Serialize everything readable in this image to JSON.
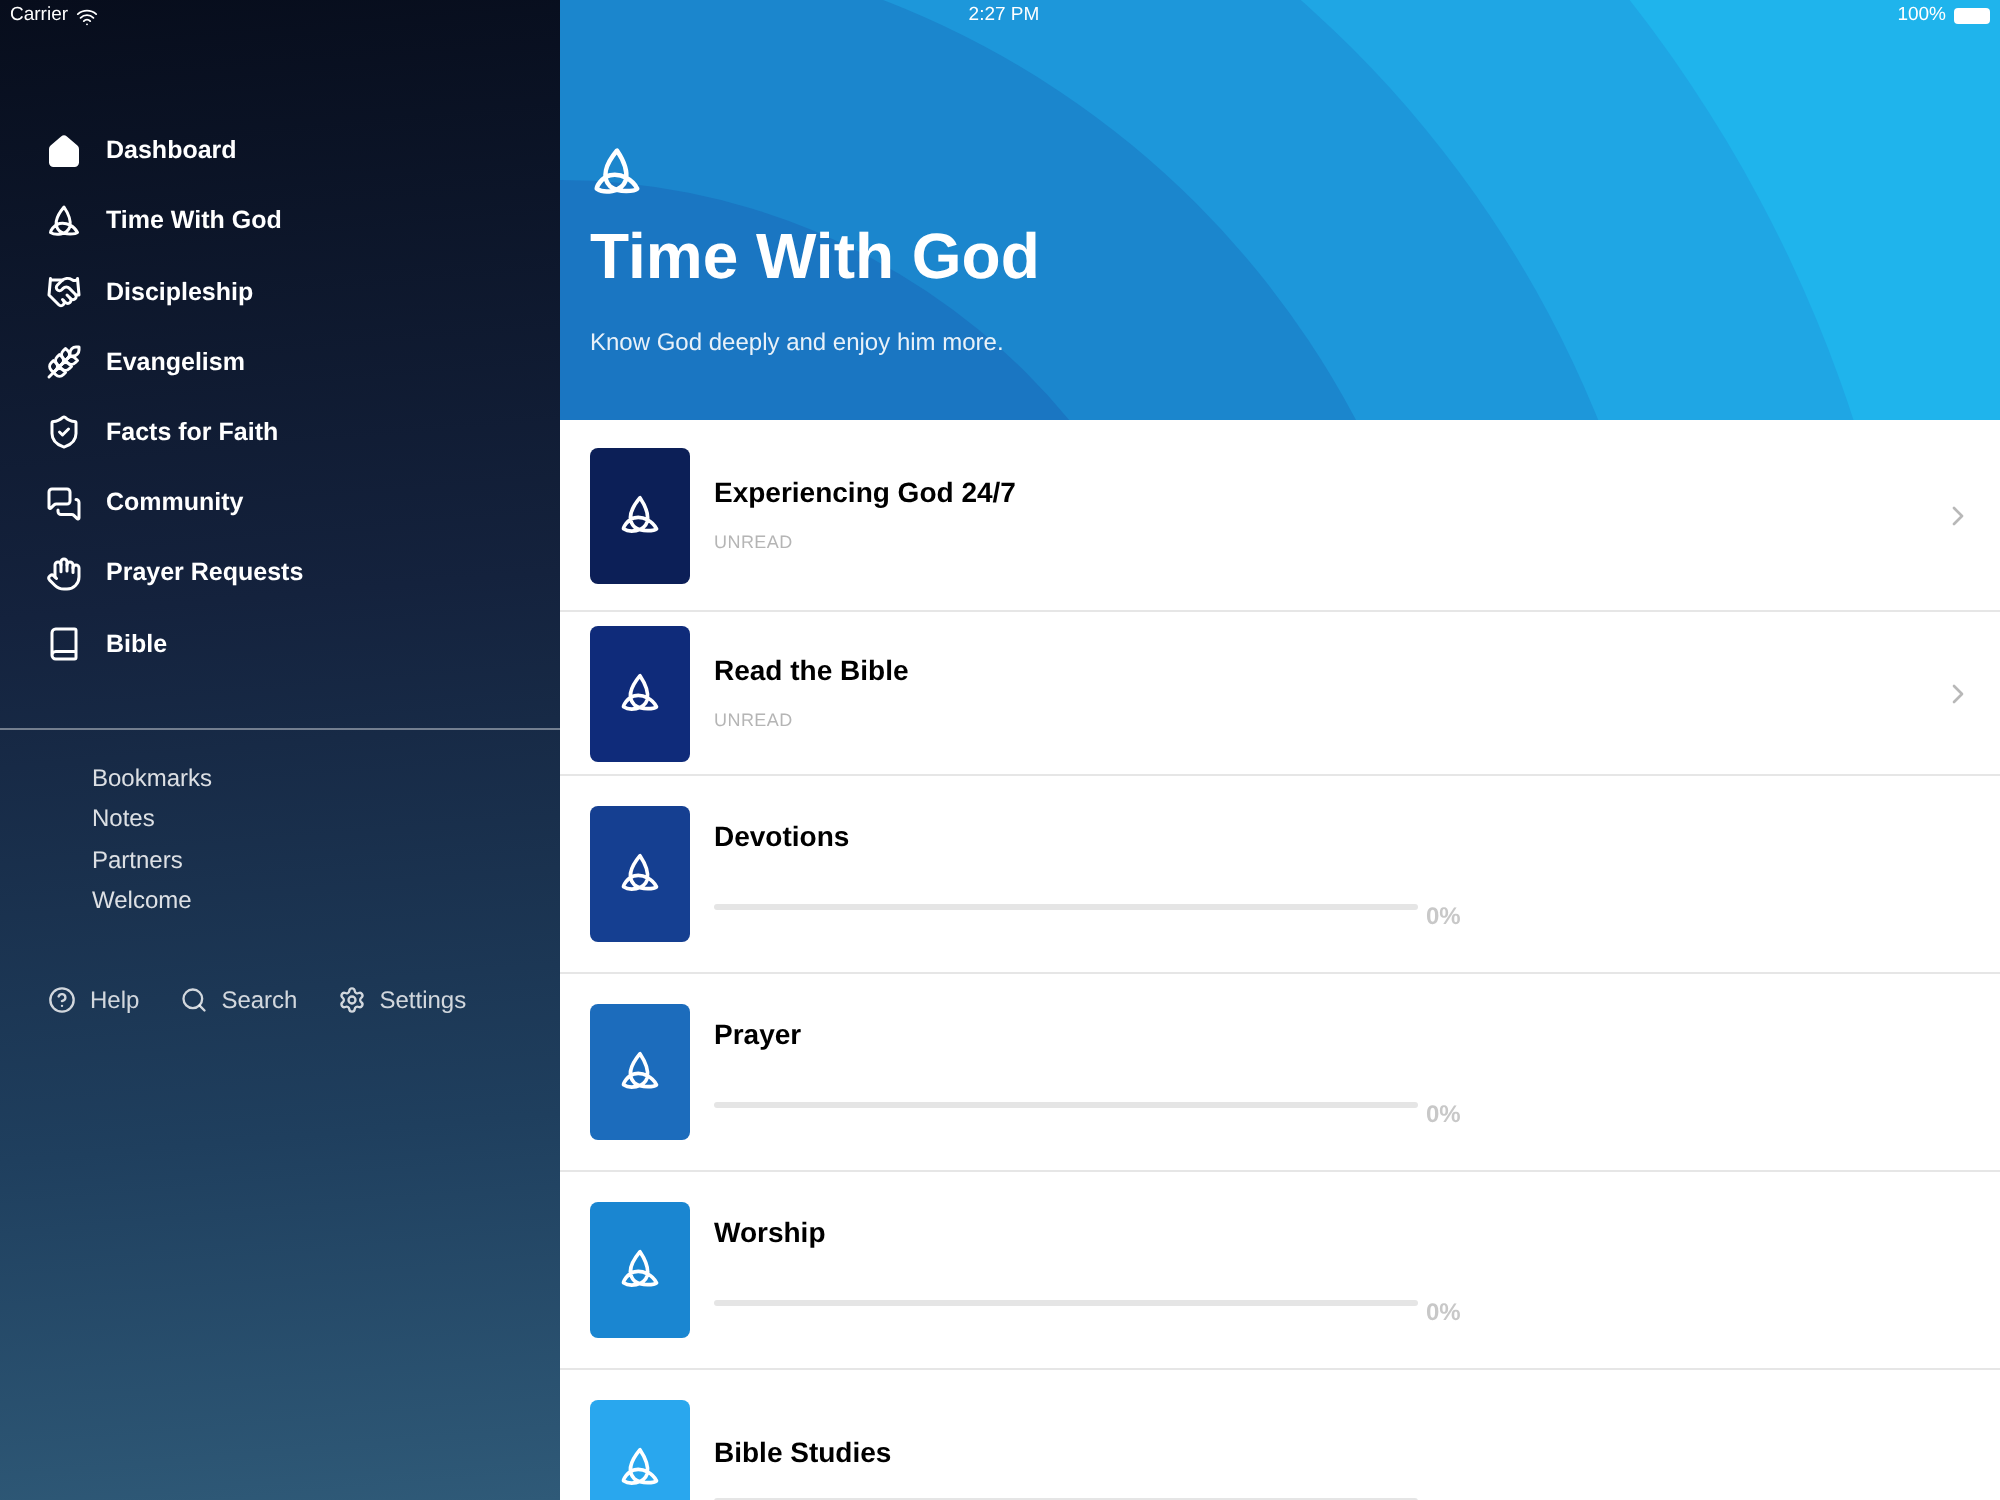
{
  "status_bar": {
    "carrier": "Carrier",
    "time": "2:27 PM",
    "battery": "100%"
  },
  "sidebar": {
    "items": [
      {
        "label": "Dashboard"
      },
      {
        "label": "Time With God"
      },
      {
        "label": "Discipleship"
      },
      {
        "label": "Evangelism"
      },
      {
        "label": "Facts for Faith"
      },
      {
        "label": "Community"
      },
      {
        "label": "Prayer Requests"
      },
      {
        "label": "Bible"
      }
    ],
    "links": [
      "Bookmarks",
      "Notes",
      "Partners",
      "Welcome"
    ],
    "footer": [
      {
        "label": "Help"
      },
      {
        "label": "Search"
      },
      {
        "label": "Settings"
      }
    ]
  },
  "header": {
    "title": "Time With God",
    "subtitle": "Know God deeply and enjoy him more."
  },
  "rows": [
    {
      "kind": "status",
      "title": "Experiencing God 24/7",
      "status": "UNREAD",
      "color": "#0c1f57"
    },
    {
      "kind": "status",
      "title": "Read the Bible",
      "status": "UNREAD",
      "color": "#0f2b7a"
    },
    {
      "kind": "progress",
      "title": "Devotions",
      "level": 0,
      "reading": "0%",
      "color": "#153f91"
    },
    {
      "kind": "progress",
      "title": "Prayer",
      "level": 0,
      "reading": "0%",
      "color": "#1c6cbc"
    },
    {
      "kind": "progress",
      "title": "Worship",
      "level": 0,
      "reading": "0%",
      "color": "#1a86d1"
    },
    {
      "kind": "progress",
      "title": "Bible Studies",
      "level": 0,
      "color": "#29a7ee"
    }
  ]
}
